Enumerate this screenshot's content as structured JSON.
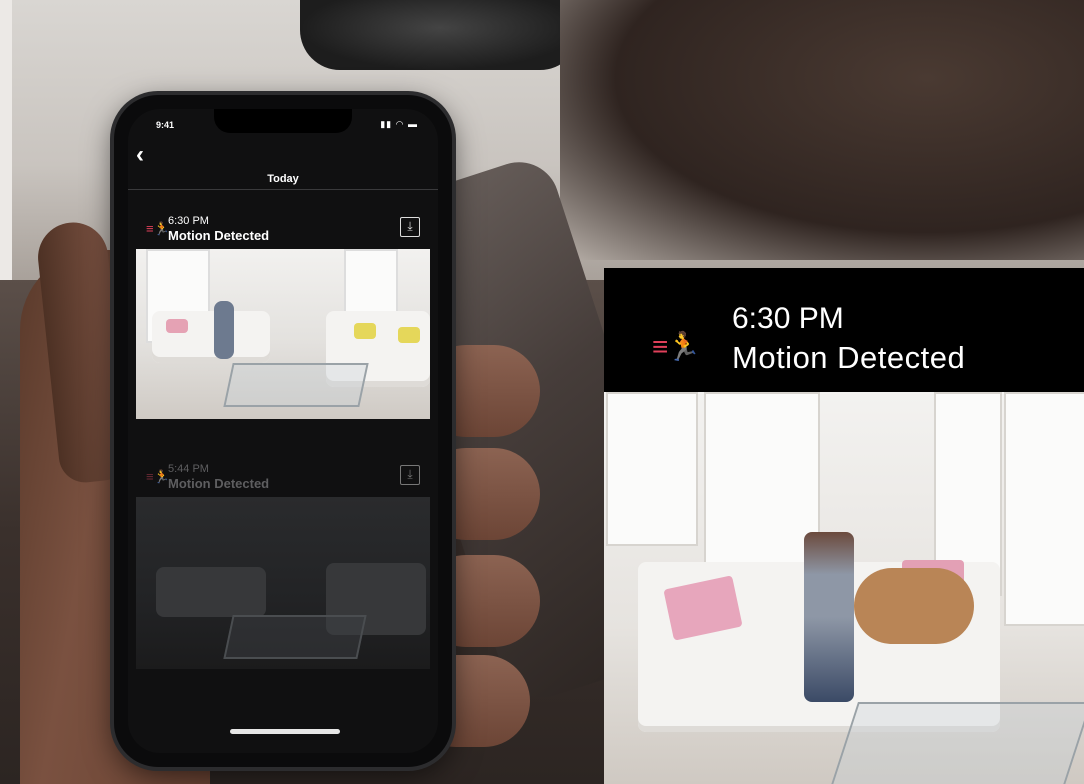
{
  "phone": {
    "status_time": "9:41",
    "status_icons": "▮▮ ◠ ▬",
    "back_icon": "‹",
    "header_title": "Today",
    "events": [
      {
        "time": "6:30 PM",
        "title": "Motion Detected",
        "icon": "running-person-icon",
        "download_icon": "⤓",
        "active": true
      },
      {
        "time": "5:44 PM",
        "title": "Motion Detected",
        "icon": "running-person-icon",
        "download_icon": "⤓",
        "active": false
      }
    ]
  },
  "overlay": {
    "time": "6:30 PM",
    "title": "Motion Detected",
    "icon_glyph": "≡🏃"
  },
  "colors": {
    "accent": "#e0405a",
    "app_bg": "#101011",
    "header_bg": "#000000"
  }
}
